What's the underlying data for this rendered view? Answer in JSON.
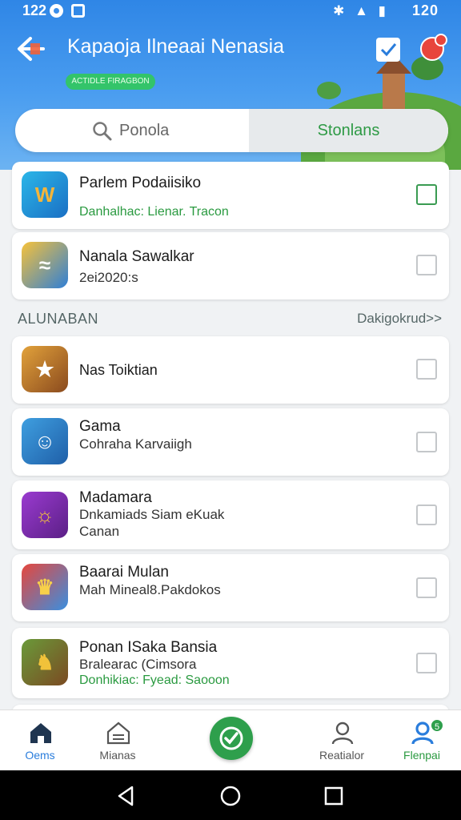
{
  "status_bar": {
    "time": "122",
    "right_time": "120"
  },
  "header": {
    "title": "Kapaoja Ilneaai Nenasia",
    "chip": "ACTIDLE FIRAGBON"
  },
  "segmented": {
    "left_label": "Ponola",
    "right_label": "Stonlans"
  },
  "cards_top": [
    {
      "title": "Parlem Podaiisiko",
      "line2": "Danhalhac: Lienar. Tracon",
      "line2_green": true,
      "checked": true,
      "icon_glyph": "W"
    },
    {
      "title": "Nanala Sawalkar",
      "line2": "2ei2020:s",
      "checked": false,
      "icon_glyph": "≈"
    }
  ],
  "section": {
    "title": "ALUNABAN",
    "link": "Dakigokrud>>"
  },
  "cards": [
    {
      "title": "Nas Toiktian",
      "line2": "",
      "line3": "",
      "icon_glyph": "★",
      "colors": [
        "#e2a23b",
        "#8a4a1e"
      ]
    },
    {
      "title": "Gama",
      "line2": "Cohraha Karvaiigh",
      "line3": "",
      "icon_glyph": "☺",
      "colors": [
        "#3f9fe0",
        "#1f5fa8"
      ]
    },
    {
      "title": "Madamara",
      "line2": "Dnkamiads Siam eKuak",
      "line3": "Canan",
      "icon_glyph": "☼",
      "colors": [
        "#9a3bd0",
        "#5b1f86"
      ]
    },
    {
      "title": "Baarai Mulan",
      "line2": "Mah Mineal8.Pakdokos",
      "line3": "",
      "icon_glyph": "♛",
      "colors": [
        "#e7463c",
        "#3a8fe0"
      ]
    },
    {
      "title": "Ponan ISaka Bansia",
      "line2": "Bralearac (Cimsora",
      "line3": "Donhikiac: Fyead: Saooon",
      "line3_green": true,
      "icon_glyph": "♞",
      "colors": [
        "#6a9a3a",
        "#7b4a22"
      ]
    }
  ],
  "bottom_nav": {
    "home": "Oems",
    "tab2": "Mianas",
    "tab4": "Reatialor",
    "tab5": "Flenpai",
    "badge": "5"
  },
  "colors": {
    "accent_green": "#2e9f4c",
    "header_blue": "#2f86e6",
    "nav_blue": "#2a7ddc"
  }
}
